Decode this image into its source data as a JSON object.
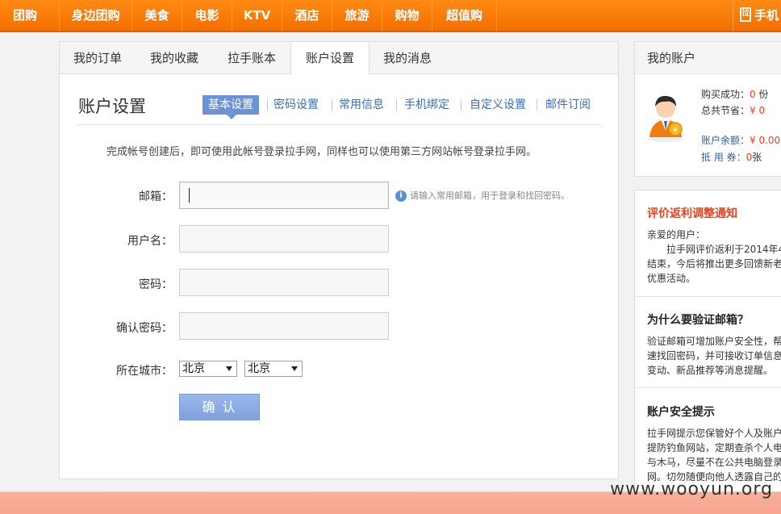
{
  "topnav": {
    "items": [
      "团购",
      "身边团购",
      "美食",
      "电影",
      "KTV",
      "酒店",
      "旅游",
      "购物",
      "超值购"
    ],
    "phone_label": "手机",
    "phone_icon": "phone-icon"
  },
  "main": {
    "tabs": [
      "我的订单",
      "我的收藏",
      "拉手账本",
      "账户设置",
      "我的消息"
    ],
    "active_tab": "账户设置",
    "page_title": "账户设置",
    "subtabs": [
      "基本设置",
      "密码设置",
      "常用信息",
      "手机绑定",
      "自定义设置",
      "邮件订阅"
    ],
    "active_subtab": "基本设置",
    "intro": "完成帐号创建后，即可使用此帐号登录拉手网，同样也可以使用第三方网站帐号登录拉手网。",
    "form": {
      "email_label": "邮箱：",
      "email_value": "",
      "email_hint": "请输入常用邮箱，用于登录和找回密码。",
      "username_label": "用户名：",
      "username_value": "",
      "password_label": "密码：",
      "password_value": "",
      "confirm_password_label": "确认密码：",
      "confirm_password_value": "",
      "city_label": "所在城市：",
      "province_selected": "北京",
      "city_selected": "北京",
      "submit_label": "确 认"
    }
  },
  "sidebar": {
    "account": {
      "title": "我的账户",
      "purchase_label": "购买成功：",
      "purchase_value": "0",
      "purchase_unit": "份",
      "saved_label": "总共节省：",
      "saved_value": "¥ 0",
      "balance_label": "账户余额：",
      "balance_value": "¥ 0.00",
      "voucher_label": "抵 用 券：",
      "voucher_value": "0",
      "voucher_unit": "张"
    },
    "notice1": {
      "title": "评价返利调整通知",
      "lines": [
        "亲爱的用户：",
        "　　拉手网评价返利于2014年4",
        "结束，今后将推出更多回馈新老",
        "优惠活动。"
      ]
    },
    "notice2": {
      "title": "为什么要验证邮箱？",
      "lines": [
        "验证邮箱可增加账户安全性，帮",
        "速找回密码，并可接收订单信息",
        "变动、新品推荐等消息提醒。"
      ]
    },
    "notice3": {
      "title": "账户安全提示",
      "lines": [
        "拉手网提示您保管好个人及账户",
        "提防钓鱼网站，定期查杀个人电",
        "与木马，尽量不在公共电脑登录",
        "网。切勿随便向他人透露自己的"
      ]
    }
  },
  "watermark": "www.wooyun.org",
  "colors": {
    "nav_orange": "#f36f00",
    "link_blue": "#3b6dbf",
    "accent_red": "#e8431e",
    "button_blue": "#7fa2dc"
  }
}
